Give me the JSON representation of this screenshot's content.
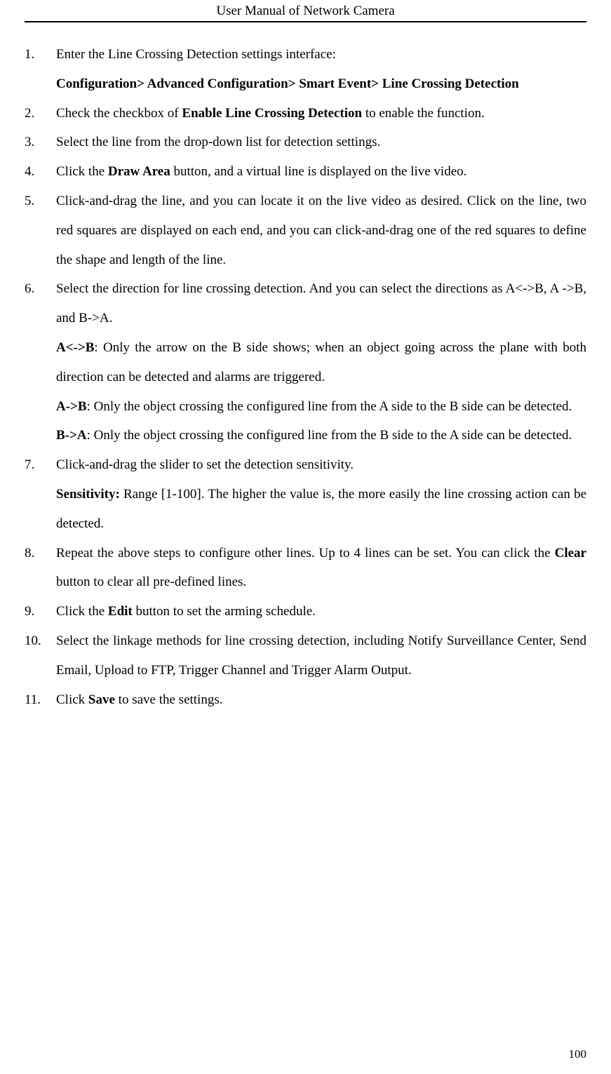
{
  "header": {
    "title": "User Manual of Network Camera"
  },
  "steps": {
    "s1": {
      "text_a": "Enter the Line Crossing Detection settings interface:",
      "path": "Configuration> Advanced Configuration> Smart Event> Line Crossing Detection"
    },
    "s2": {
      "text_a": "Check the checkbox of ",
      "bold_a": "Enable Line Crossing Detection",
      "text_b": " to enable the function."
    },
    "s3": {
      "text_a": "Select the line from the drop-down list for detection settings."
    },
    "s4": {
      "text_a": "Click the ",
      "bold_a": "Draw Area",
      "text_b": " button, and a virtual line is displayed on the live video."
    },
    "s5": {
      "text_a": "Click-and-drag the line, and you can locate it on the live video as desired. Click on the line, two red squares are displayed on each end, and you can click-and-drag one of the red squares to define the shape and length of the line."
    },
    "s6": {
      "text_a": "Select the direction for line crossing detection. And you can select the directions as A<->B, A ->B, and B->A.",
      "dir_ab_both_label": "A<->B",
      "dir_ab_both_text": ": Only the arrow on the B side shows; when an object going across the plane with both direction can be detected and alarms are triggered.",
      "dir_ab_label": "A->B",
      "dir_ab_text": ": Only the object crossing the configured line from the A side to the B side can be detected.",
      "dir_ba_label": "B->A",
      "dir_ba_text": ": Only the object crossing the configured line from the B side to the A side can be detected."
    },
    "s7": {
      "text_a": "Click-and-drag the slider to set the detection sensitivity.",
      "sens_label": "Sensitivity:",
      "sens_text": " Range [1-100]. The higher the value is, the more easily the line crossing action can be detected."
    },
    "s8": {
      "text_a": "Repeat the above steps to configure other lines. Up to 4 lines can be set. You can click the ",
      "bold_a": "Clear",
      "text_b": " button to clear all pre-defined lines."
    },
    "s9": {
      "text_a": "Click the ",
      "bold_a": "Edit",
      "text_b": " button to set the arming schedule."
    },
    "s10": {
      "text_a": "Select the linkage methods for line crossing detection, including Notify Surveillance Center, Send Email, Upload to FTP, Trigger Channel and Trigger Alarm Output."
    },
    "s11": {
      "text_a": "Click ",
      "bold_a": "Save",
      "text_b": " to save the settings."
    }
  },
  "footer": {
    "page_number": "100"
  }
}
